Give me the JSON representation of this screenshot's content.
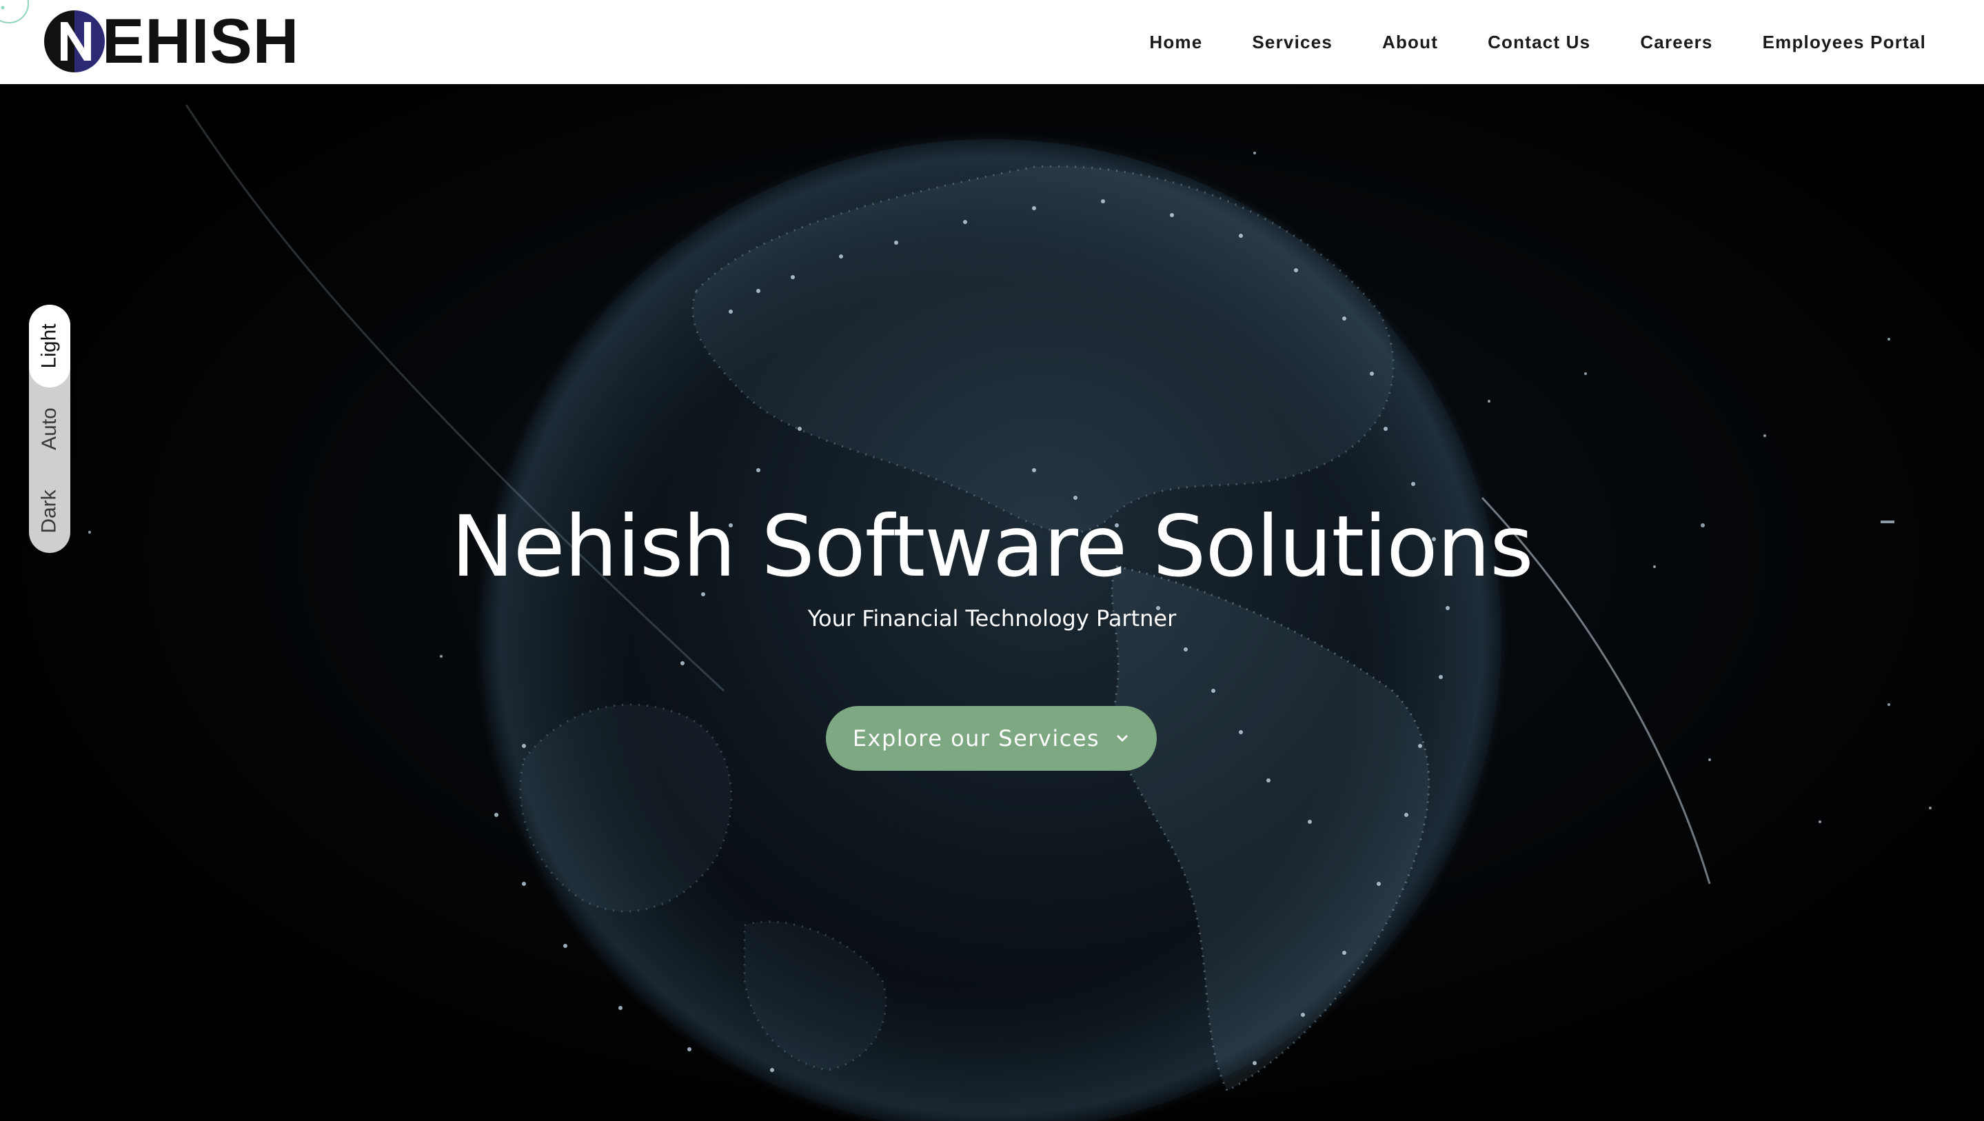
{
  "brand": {
    "name": "EHISH",
    "logo_letter": "N",
    "logo_colors": {
      "dark": "#111111",
      "accent": "#2b2a72"
    }
  },
  "nav": {
    "items": [
      {
        "label": "Home"
      },
      {
        "label": "Services"
      },
      {
        "label": "About"
      },
      {
        "label": "Contact Us"
      },
      {
        "label": "Careers"
      },
      {
        "label": "Employees Portal"
      }
    ]
  },
  "theme_toggle": {
    "options": [
      {
        "label": "Light",
        "active": true
      },
      {
        "label": "Auto",
        "active": false
      },
      {
        "label": "Dark",
        "active": false
      }
    ]
  },
  "hero": {
    "title": "Nehish Software Solutions",
    "subtitle": "Your Financial Technology Partner",
    "cta": {
      "label": "Explore our Services",
      "icon": "chevron-down-icon",
      "color": "#7ea882"
    },
    "background": "globe-particles-image"
  }
}
